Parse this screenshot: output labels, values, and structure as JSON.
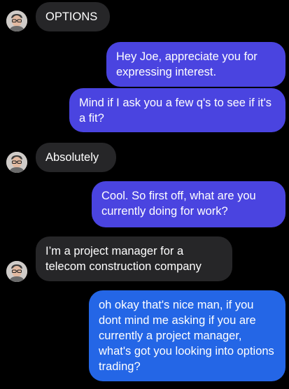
{
  "conversation": {
    "messages": [
      {
        "id": "m1",
        "direction": "incoming",
        "text": "OPTIONS",
        "avatar": "contact-avatar-joe"
      },
      {
        "id": "m2",
        "direction": "outgoing",
        "text": "Hey Joe, appreciate you for expressing interest."
      },
      {
        "id": "m3",
        "direction": "outgoing",
        "text": "Mind if I ask you a few q's to see if it's a fit?"
      },
      {
        "id": "m4",
        "direction": "incoming",
        "text": "Absolutely",
        "avatar": "contact-avatar-joe"
      },
      {
        "id": "m5",
        "direction": "outgoing",
        "text": "Cool. So first off, what are you currently doing for work?"
      },
      {
        "id": "m6",
        "direction": "incoming",
        "text": "I’m a project manager for a telecom construction company",
        "avatar": "contact-avatar-joe"
      },
      {
        "id": "m7",
        "direction": "outgoing",
        "text": "oh okay that's nice man, if you dont mind me asking if you are currently a project manager, what's got you looking into options trading?"
      }
    ]
  },
  "colors": {
    "background": "#000000",
    "incoming_bubble": "#262628",
    "outgoing_bubble_purple": "#4a44e0",
    "outgoing_bubble_blue": "#2466e6",
    "text": "#ffffff"
  }
}
